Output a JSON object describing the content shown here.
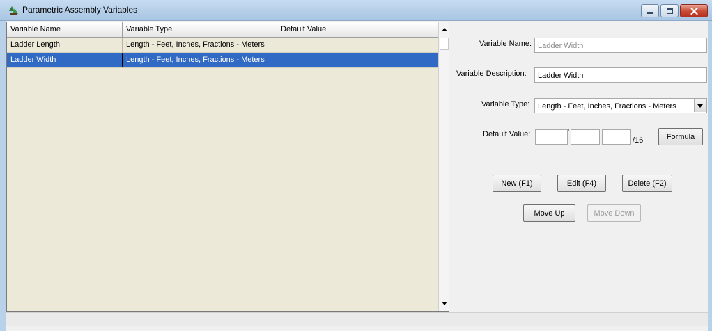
{
  "window": {
    "title": "Parametric Assembly Variables",
    "icon": "assembly-tree-icon",
    "controls": [
      "minimize-icon",
      "maximize-icon",
      "close-icon"
    ]
  },
  "grid": {
    "headers": [
      "Variable Name",
      "Variable Type",
      "Default Value"
    ],
    "rows": [
      {
        "name": "Ladder Length",
        "type": "Length - Feet, Inches, Fractions - Meters",
        "default": ""
      },
      {
        "name": "Ladder Width",
        "type": "Length - Feet, Inches, Fractions - Meters",
        "default": ""
      }
    ],
    "selected_row": 1
  },
  "form": {
    "variable_name_label": "Variable Name:",
    "variable_name_value": "Ladder Width",
    "variable_description_label": "Variable Description:",
    "variable_description_value": "Ladder Width",
    "variable_type_label": "Variable Type:",
    "variable_type_value": "Length - Feet, Inches, Fractions - Meters",
    "default_value_label": "Default Value:",
    "feet_value": "",
    "feet_mark": "'",
    "inches_value": "",
    "fraction_value": "",
    "fraction_suffix": "/16",
    "formula_button": "Formula"
  },
  "buttons": {
    "new": "New (F1)",
    "edit": "Edit (F4)",
    "delete": "Delete (F2)",
    "move_up": "Move Up",
    "move_down": "Move Down"
  },
  "colors": {
    "selection": "#316ac5",
    "grid_background": "#ece9d8",
    "close_button": "#c84a35"
  }
}
